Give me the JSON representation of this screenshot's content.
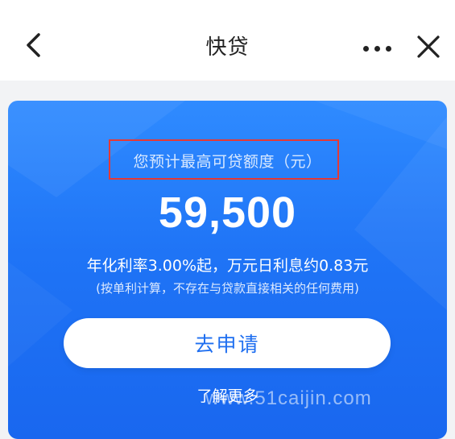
{
  "header": {
    "title": "快贷",
    "back_icon": "chevron-left-icon",
    "more_icon": "more-dots-icon",
    "close_icon": "close-icon"
  },
  "card": {
    "limit_label": "您预计最高可贷额度（元）",
    "amount": "59,500",
    "rate_text": "年化利率3.00%起，万元日利息约0.83元",
    "note_text": "(按单利计算，不存在与贷款直接相关的任何费用)",
    "apply_label": "去申请",
    "learn_more_label": "了解更多",
    "highlight_color": "#e53935",
    "accent_color": "#1f74f6"
  },
  "watermark": "www.51caijin.com"
}
